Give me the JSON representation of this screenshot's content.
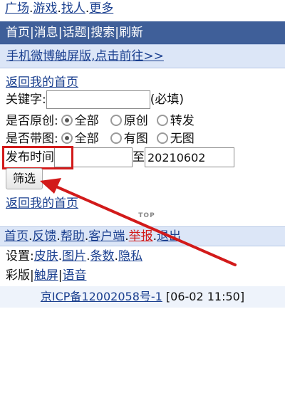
{
  "top_links": [
    "广场",
    "游戏",
    "找人",
    "更多"
  ],
  "nav": {
    "items": [
      "首页",
      "消息",
      "话题",
      "搜索",
      "刷新"
    ]
  },
  "promo": {
    "text": "手机微博触屏版,点击前往>>"
  },
  "back_home": "返回我的首页",
  "form": {
    "keyword_label": "关键字:",
    "keyword_value": "",
    "keyword_required": "(必填)",
    "original_label": "是否原创:",
    "original_options": [
      "全部",
      "原创",
      "转发"
    ],
    "original_selected": "全部",
    "image_label": "是否带图:",
    "image_options": [
      "全部",
      "有图",
      "无图"
    ],
    "image_selected": "全部",
    "time_label": "发布时间",
    "time_from": "",
    "time_to_label": "至",
    "time_to": "20210602",
    "filter_button": "筛选"
  },
  "back_home_2": "返回我的首页",
  "logo_text": "TOP",
  "footer": {
    "links": [
      "首页",
      "反馈",
      "帮助",
      "客户端",
      "举报",
      "退出"
    ],
    "settings_label": "设置:",
    "settings_links": [
      "皮肤",
      "图片",
      "条数",
      "隐私"
    ],
    "color_version": "彩版",
    "touch_link": "触屏",
    "voice_link": "语音",
    "icp_link": "京ICP备12002058号-1",
    "timestamp": "[06-02 11:50]"
  },
  "annotation": {
    "color": "#d21a1a"
  }
}
